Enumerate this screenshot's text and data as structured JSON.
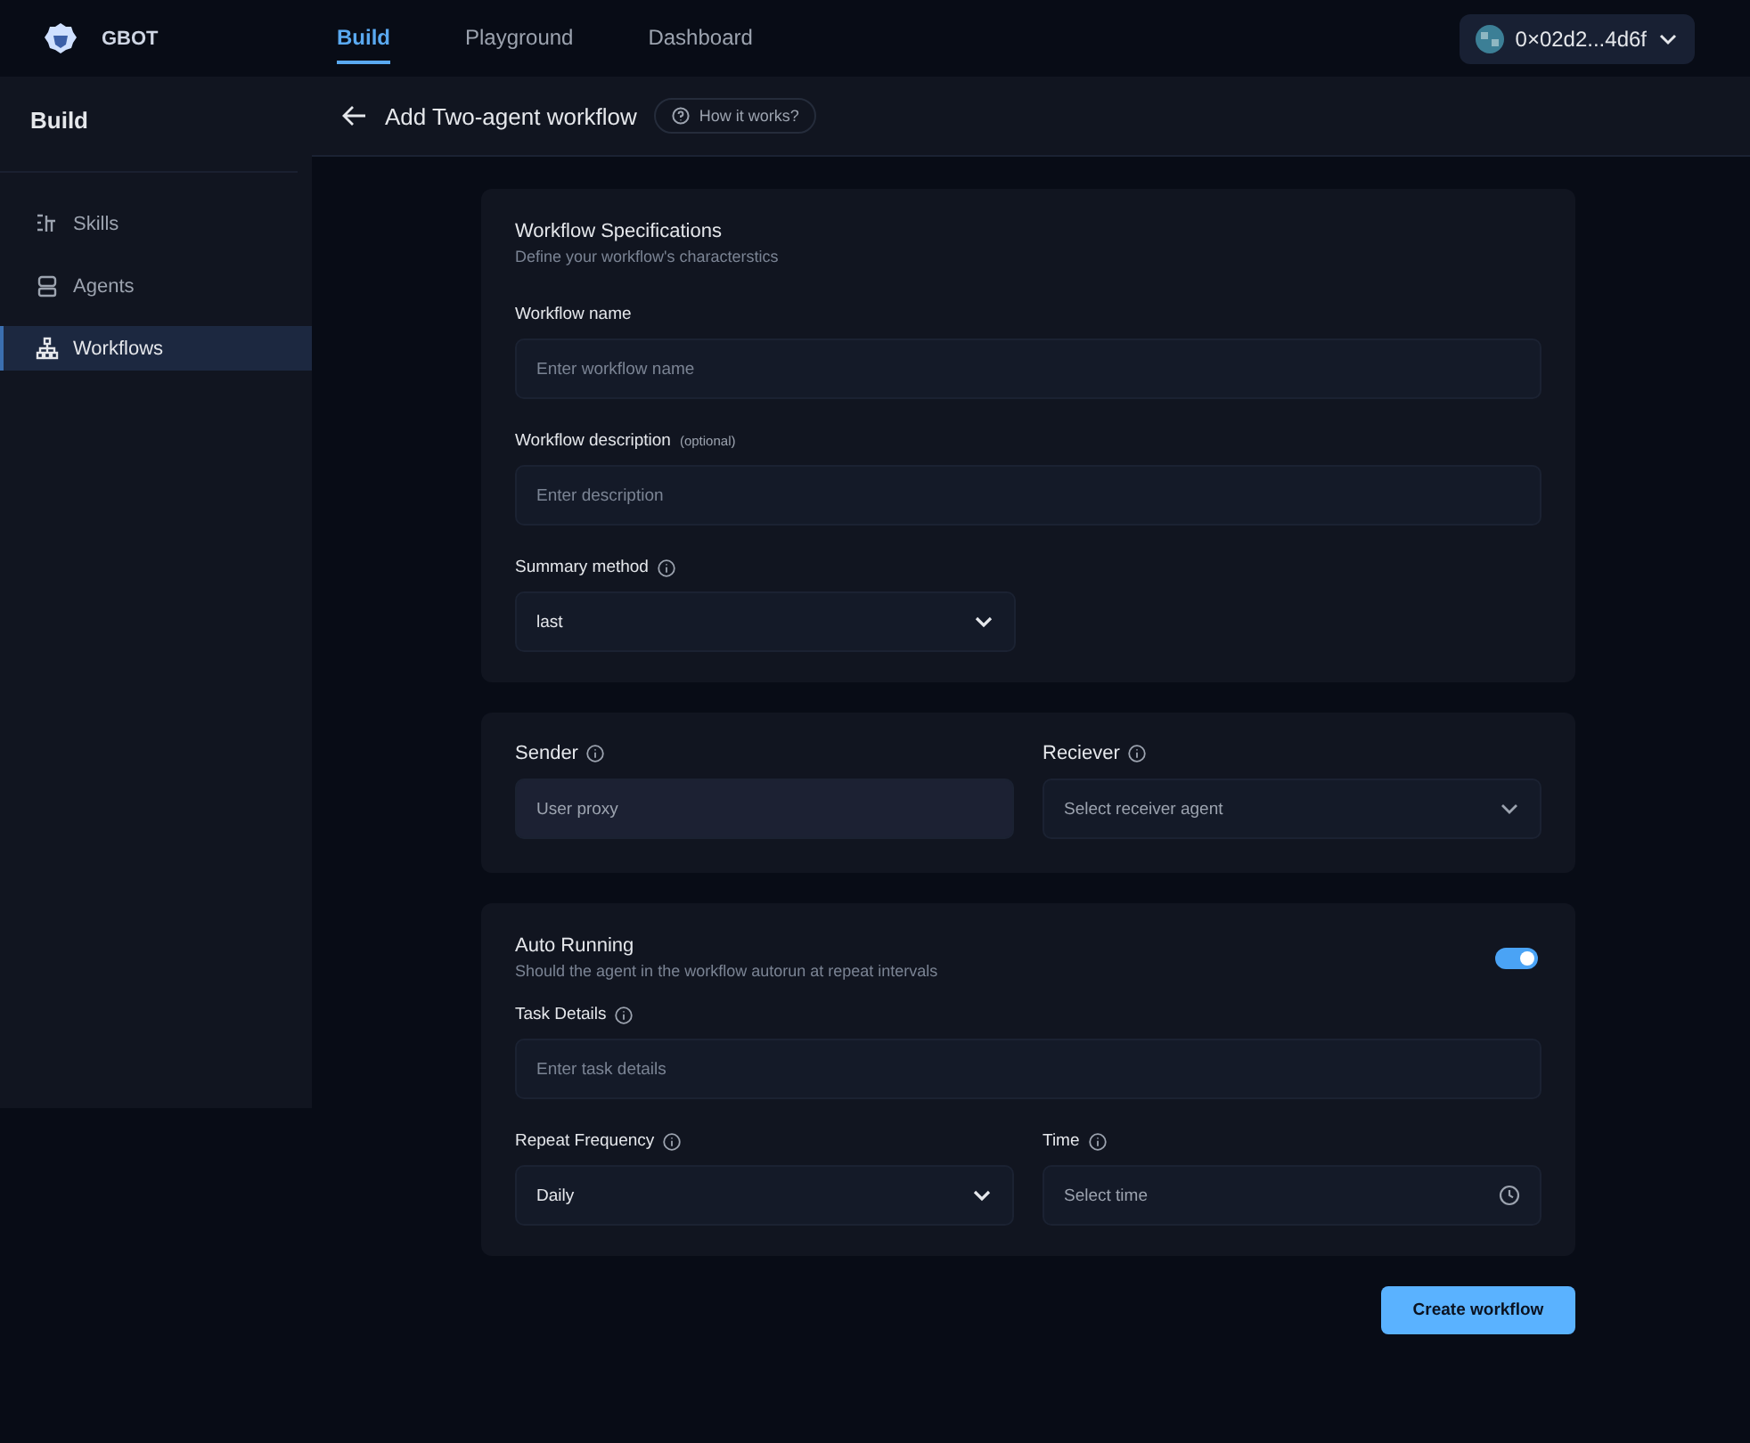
{
  "brand": "GBOT",
  "nav": [
    {
      "label": "Build",
      "selected": true
    },
    {
      "label": "Playground",
      "selected": false
    },
    {
      "label": "Dashboard",
      "selected": false
    }
  ],
  "account": {
    "address": "0×02d2...4d6f"
  },
  "sidebar": {
    "title": "Build",
    "items": [
      {
        "label": "Skills",
        "kind": "skills",
        "selected": false
      },
      {
        "label": "Agents",
        "kind": "agents",
        "selected": false
      },
      {
        "label": "Workflows",
        "kind": "workflows",
        "selected": true
      }
    ]
  },
  "header": {
    "title": "Add Two-agent workflow",
    "help": "How it works?"
  },
  "specs": {
    "title": "Workflow Specifications",
    "subtitle": "Define your workflow's characterstics",
    "name": {
      "label": "Workflow name",
      "placeholder": "Enter workflow name"
    },
    "description": {
      "label": "Workflow description",
      "note": "(optional)",
      "placeholder": "Enter description"
    },
    "summary": {
      "label": "Summary method",
      "value": "last"
    }
  },
  "agents": {
    "sender": {
      "label": "Sender",
      "value": "User proxy"
    },
    "receiver": {
      "label": "Reciever",
      "placeholder": "Select receiver agent"
    }
  },
  "auto": {
    "title": "Auto Running",
    "subtitle": "Should the agent in the workflow autorun at repeat intervals",
    "on": true,
    "task": {
      "label": "Task Details",
      "placeholder": "Enter task details"
    },
    "frequency": {
      "label": "Repeat Frequency",
      "value": "Daily"
    },
    "time": {
      "label": "Time",
      "placeholder": "Select time"
    }
  },
  "submit": "Create workflow"
}
